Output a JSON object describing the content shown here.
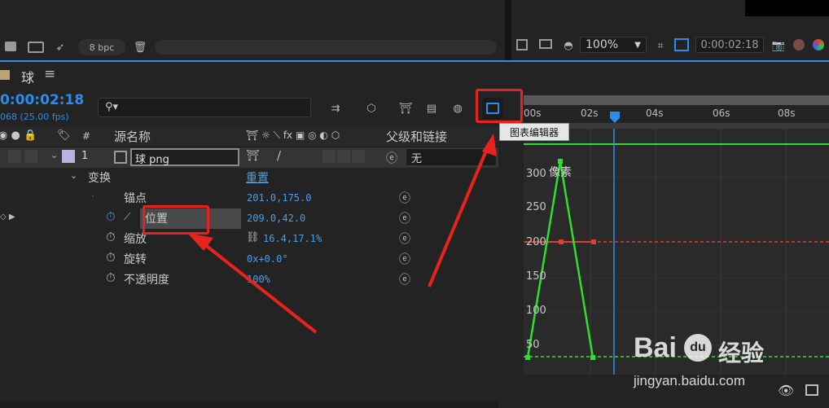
{
  "top_toolbar": {
    "bpc_label": "8 bpc",
    "zoom_value": "100%",
    "timecode": "0:00:02:18"
  },
  "comp_tab": {
    "name": "球",
    "menu_glyph": "≡"
  },
  "timeline": {
    "current_time": "0:00:02:18",
    "frame_info": "068 (25.00 fps)",
    "search_placeholder": "",
    "columns": {
      "number": "#",
      "source_name": "源名称",
      "parent": "父级和链接"
    },
    "layer": {
      "index": "1",
      "name": "球 png",
      "parent_value": "无"
    },
    "transform_group": {
      "label": "变换",
      "reset": "重置"
    },
    "properties": [
      {
        "name": "锚点",
        "value": "201.0,175.0"
      },
      {
        "name": "位置",
        "value": "209.0,42.0"
      },
      {
        "name": "缩放",
        "value": "16.4,17.1%"
      },
      {
        "name": "旋转",
        "value": "0x+0.0°"
      },
      {
        "name": "不透明度",
        "value": "100%"
      }
    ]
  },
  "graph_editor": {
    "tooltip": "图表编辑器",
    "ruler_labels": [
      "00s",
      "02s",
      "04s",
      "06s",
      "08s"
    ],
    "unit_label": "像素",
    "y_labels": [
      "300",
      "250",
      "200",
      "150",
      "100",
      "50"
    ]
  },
  "watermark": {
    "brand": "Bai",
    "brand_tail": "du",
    "cn": "经验",
    "url": "jingyan.baidu.com"
  },
  "colors": {
    "accent_blue": "#2d8ceb",
    "annotation_red": "#e8231d",
    "curve_green": "#2ee02e",
    "dashed_red": "#e03c3c"
  }
}
